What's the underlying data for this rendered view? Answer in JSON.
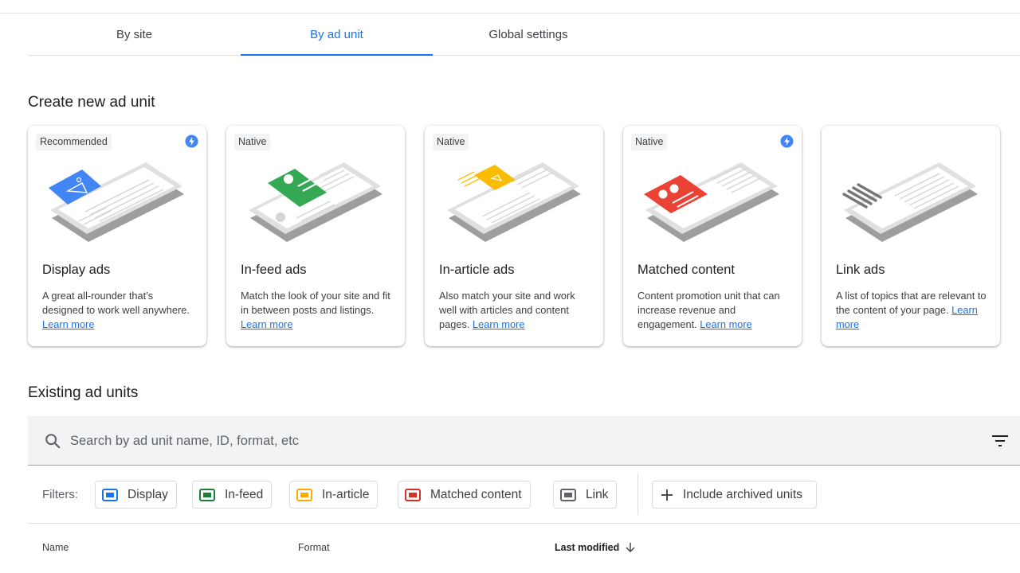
{
  "tabs": [
    {
      "label": "By site"
    },
    {
      "label": "By ad unit"
    },
    {
      "label": "Global settings"
    }
  ],
  "active_tab": "By ad unit",
  "create_section": {
    "title": "Create new ad unit",
    "learn_more": "Learn more",
    "cards": [
      {
        "badge": "Recommended",
        "boosted": true,
        "title": "Display ads",
        "description": "A great all-rounder that’s designed to work well anywhere.",
        "accent": "#4285f4"
      },
      {
        "badge": "Native",
        "boosted": false,
        "title": "In-feed ads",
        "description": "Match the look of your site and fit in between posts and listings.",
        "accent": "#34a853"
      },
      {
        "badge": "Native",
        "boosted": false,
        "title": "In-article ads",
        "description": "Also match your site and work well with articles and content pages.",
        "accent": "#fbbc04"
      },
      {
        "badge": "Native",
        "boosted": true,
        "title": "Matched content",
        "description": "Content promotion unit that can increase revenue and engagement.",
        "accent": "#ea4335"
      },
      {
        "badge": "",
        "boosted": false,
        "title": "Link ads",
        "description": "A list of topics that are relevant to the content of your page.",
        "accent": "#9aa0a6"
      }
    ]
  },
  "existing_section": {
    "title": "Existing ad units",
    "search": {
      "placeholder": "Search by ad unit name, ID, format, etc",
      "value": "",
      "icon": "search-icon",
      "filter_icon": "filter-list-icon"
    },
    "filters_label": "Filters:",
    "filters": [
      {
        "label": "Display",
        "color": "#1a73e8"
      },
      {
        "label": "In-feed",
        "color": "#188038"
      },
      {
        "label": "In-article",
        "color": "#f9ab00"
      },
      {
        "label": "Matched content",
        "color": "#d93025"
      },
      {
        "label": "Link",
        "color": "#5f6368"
      }
    ],
    "archived_button": "Include archived units",
    "table_headers": {
      "name": "Name",
      "format": "Format",
      "last_modified": "Last modified"
    },
    "sort": "descending"
  },
  "colors": {
    "primary": "#1a73e8",
    "boost": "#4285f4"
  }
}
